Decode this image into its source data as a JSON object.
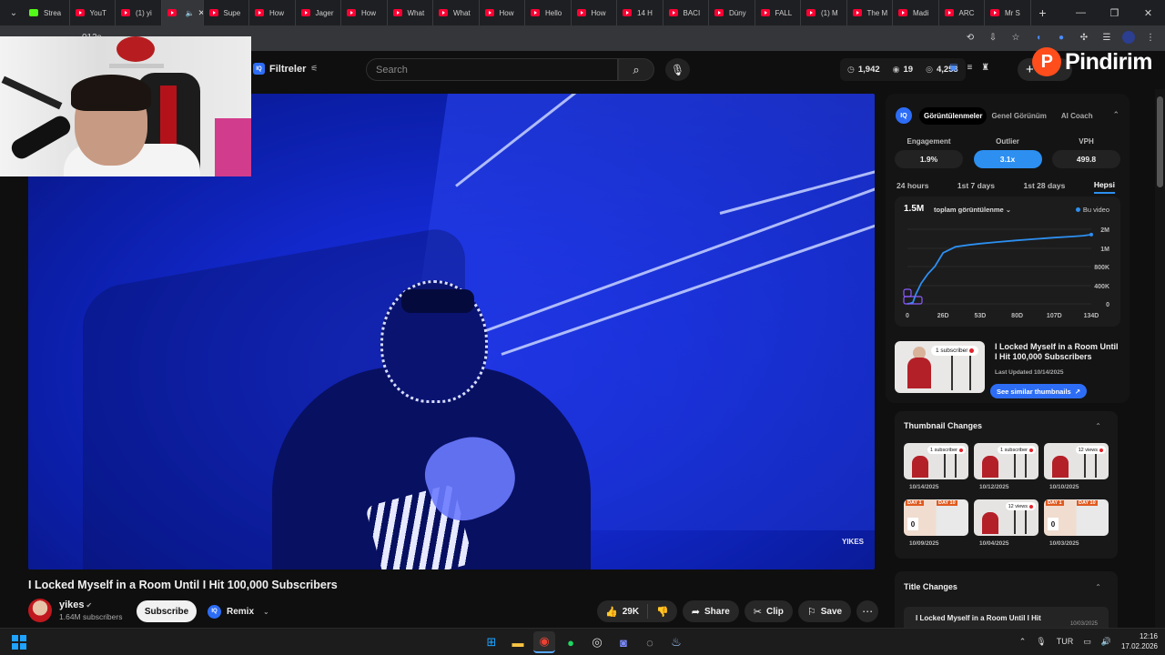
{
  "browser": {
    "tabs": [
      {
        "label": "Strea",
        "favicon": "kick-icon"
      },
      {
        "label": "YouT",
        "favicon": "youtube-icon"
      },
      {
        "label": "(1) yi",
        "favicon": "youtube-icon"
      },
      {
        "label": "",
        "favicon": "youtube-icon",
        "active": true
      },
      {
        "label": "Supe",
        "favicon": "youtube-icon"
      },
      {
        "label": "How",
        "favicon": "youtube-icon"
      },
      {
        "label": "Jager",
        "favicon": "youtube-icon"
      },
      {
        "label": "How",
        "favicon": "youtube-icon"
      },
      {
        "label": "What",
        "favicon": "youtube-icon"
      },
      {
        "label": "What",
        "favicon": "youtube-icon"
      },
      {
        "label": "How",
        "favicon": "youtube-icon"
      },
      {
        "label": "Hello",
        "favicon": "youtube-icon"
      },
      {
        "label": "How",
        "favicon": "youtube-icon"
      },
      {
        "label": "14 H",
        "favicon": "youtube-icon"
      },
      {
        "label": "BACI",
        "favicon": "youtube-icon"
      },
      {
        "label": "Düny",
        "favicon": "youtube-icon"
      },
      {
        "label": "FALL",
        "favicon": "youtube-icon"
      },
      {
        "label": "(1) M",
        "favicon": "youtube-icon"
      },
      {
        "label": "The M",
        "favicon": "youtube-icon"
      },
      {
        "label": "Madi",
        "favicon": "youtube-icon"
      },
      {
        "label": "ARC",
        "favicon": "youtube-icon"
      },
      {
        "label": "Mr S",
        "favicon": "youtube-icon"
      }
    ],
    "url_fragment": "013s"
  },
  "masthead": {
    "filters_label": "Filtreler",
    "search_placeholder": "Search",
    "stats": {
      "views": "1,942",
      "likes": "19",
      "comments": "4,253"
    },
    "create_label": "+"
  },
  "overlay_brand": {
    "name": "Pindirim",
    "logo_letter": "P"
  },
  "video": {
    "watermark": "YIKES",
    "title": "I Locked Myself in a Room Until I Hit 100,000 Subscribers",
    "channel_name": "yikes",
    "subscribers": "1.64M subscribers",
    "subscribe_label": "Subscribe",
    "remix_label": "Remix",
    "likes": "29K",
    "share_label": "Share",
    "clip_label": "Clip",
    "save_label": "Save"
  },
  "panel": {
    "tabs": [
      "Görüntülenmeler",
      "Genel Görünüm",
      "AI Coach"
    ],
    "active_tab": "Görüntülenmeler",
    "metrics": [
      {
        "label": "Engagement",
        "value": "1.9%"
      },
      {
        "label": "Outlier",
        "value": "3.1x",
        "highlight": true
      },
      {
        "label": "VPH",
        "value": "499.8"
      }
    ],
    "ranges": [
      "24 hours",
      "1st 7 days",
      "1st 28 days",
      "Hepsi"
    ],
    "active_range": "Hepsi",
    "total_views": "1.5M",
    "views_selector": "toplam görüntülenme",
    "legend": "Bu video",
    "related": {
      "badge": "1 subscriber",
      "title": "I Locked Myself in a Room Until I Hit 100,000 Subscribers",
      "updated": "Last Updated 10/14/2025",
      "button": "See similar thumbnails"
    },
    "thumbnail_changes": {
      "title": "Thumbnail Changes",
      "items": [
        {
          "date": "10/14/2025",
          "badge": "1 subscriber"
        },
        {
          "date": "10/12/2025",
          "badge": "1 subscriber"
        },
        {
          "date": "10/10/2025",
          "badge": "12 views"
        },
        {
          "date": "10/09/2025",
          "badge": "",
          "day_tags": [
            "DAY 1",
            "DAY 10"
          ],
          "number": "0"
        },
        {
          "date": "10/04/2025",
          "badge": "12 views"
        },
        {
          "date": "10/03/2025",
          "badge": "",
          "day_tags": [
            "DAY 1",
            "DAY 10"
          ],
          "number": "0"
        }
      ]
    },
    "title_changes": {
      "title": "Title Changes",
      "item_title": "I Locked Myself in a Room Until I Hit",
      "item_date": "10/03/2025"
    }
  },
  "chart_data": {
    "type": "line",
    "title": "",
    "xlabel": "",
    "ylabel": "",
    "x_ticks": [
      "0",
      "26D",
      "53D",
      "80D",
      "107D",
      "134D"
    ],
    "y_ticks": [
      "0",
      "400K",
      "800K",
      "1M",
      "2M"
    ],
    "xlim": [
      0,
      134
    ],
    "ylim": [
      0,
      2000000
    ],
    "series": [
      {
        "name": "Bu video",
        "x": [
          0,
          2,
          4,
          6,
          10,
          15,
          20,
          26,
          35,
          45,
          53,
          65,
          80,
          95,
          107,
          120,
          128,
          134
        ],
        "y": [
          0,
          10000,
          30000,
          200000,
          450000,
          650000,
          800000,
          950000,
          1080000,
          1180000,
          1250000,
          1330000,
          1420000,
          1500000,
          1560000,
          1620000,
          1660000,
          1720000
        ]
      }
    ],
    "color": "#2d8ff0"
  },
  "taskbar": {
    "lang": "TUR",
    "time": "12:16",
    "date": "17.02.2026"
  }
}
